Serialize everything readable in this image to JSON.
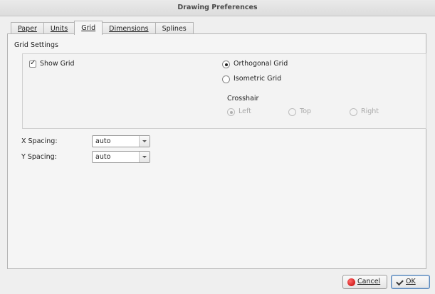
{
  "window": {
    "title": "Drawing Preferences"
  },
  "tabs": [
    {
      "label": "Paper",
      "active": false
    },
    {
      "label": "Units",
      "active": false
    },
    {
      "label": "Grid",
      "active": true
    },
    {
      "label": "Dimensions",
      "active": false
    },
    {
      "label": "Splines",
      "active": false
    }
  ],
  "grid_settings": {
    "title": "Grid Settings",
    "show_grid": {
      "label": "Show Grid",
      "checked": true
    },
    "grid_type": [
      {
        "label": "Orthogonal Grid",
        "checked": true
      },
      {
        "label": "Isometric Grid",
        "checked": false
      }
    ],
    "crosshair": {
      "title": "Crosshair",
      "enabled": false,
      "options": [
        {
          "label": "Left",
          "checked": true
        },
        {
          "label": "Top",
          "checked": false
        },
        {
          "label": "Right",
          "checked": false
        }
      ]
    }
  },
  "spacing": {
    "x": {
      "label": "X Spacing:",
      "value": "auto"
    },
    "y": {
      "label": "Y Spacing:",
      "value": "auto"
    }
  },
  "buttons": {
    "cancel_label": "Cancel",
    "ok_label": "OK"
  },
  "colors": {
    "panel_bg": "#f5f5f5",
    "dialog_bg": "#efefef",
    "cancel_icon": "#d00000",
    "default_button_border": "#5a86b8"
  },
  "icons": {
    "cancel": "cancel-icon",
    "ok": "checkmark-icon",
    "combo_arrow": "chevron-down-icon"
  }
}
